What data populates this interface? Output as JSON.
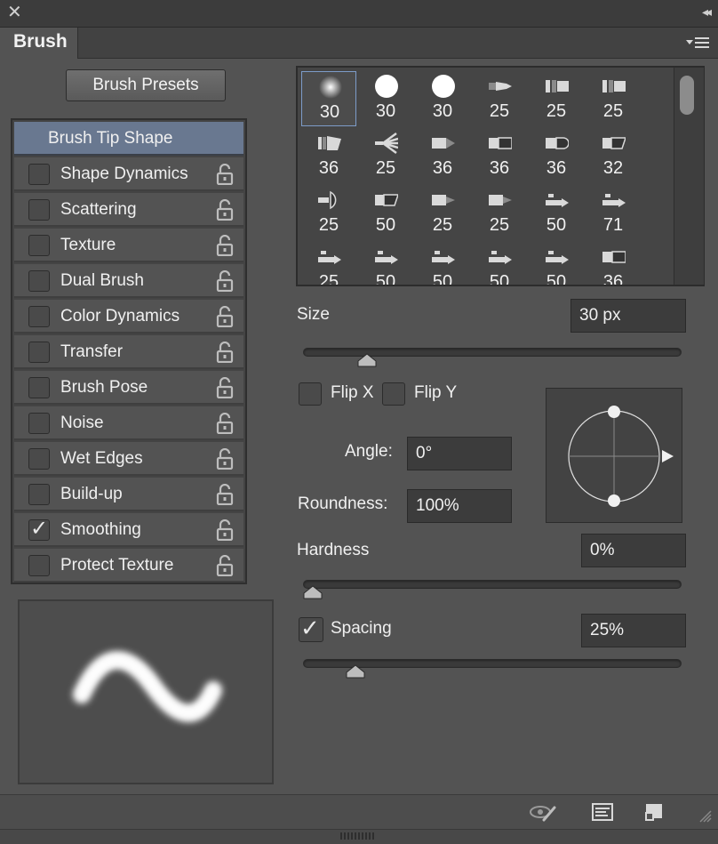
{
  "window": {
    "close_glyph": "✕",
    "collapse_glyph": "◂◂"
  },
  "tab": {
    "title": "Brush"
  },
  "presets_button": "Brush Presets",
  "options": {
    "header": "Brush Tip Shape",
    "items": [
      {
        "label": "Shape Dynamics",
        "checked": false
      },
      {
        "label": "Scattering",
        "checked": false
      },
      {
        "label": "Texture",
        "checked": false
      },
      {
        "label": "Dual Brush",
        "checked": false
      },
      {
        "label": "Color Dynamics",
        "checked": false
      },
      {
        "label": "Transfer",
        "checked": false
      },
      {
        "label": "Brush Pose",
        "checked": false
      },
      {
        "label": "Noise",
        "checked": false
      },
      {
        "label": "Wet Edges",
        "checked": false
      },
      {
        "label": "Build-up",
        "checked": false
      },
      {
        "label": "Smoothing",
        "checked": true
      },
      {
        "label": "Protect Texture",
        "checked": false
      }
    ]
  },
  "brush_grid": {
    "rows": [
      [
        {
          "size": "30",
          "tip": "soft-round"
        },
        {
          "size": "30",
          "tip": "hard-round"
        },
        {
          "size": "30",
          "tip": "hard-round"
        },
        {
          "size": "25",
          "tip": "pointed-bristle"
        },
        {
          "size": "25",
          "tip": "flat-bristle"
        },
        {
          "size": "25",
          "tip": "flat-bristle"
        }
      ],
      [
        {
          "size": "36",
          "tip": "angled-bristle"
        },
        {
          "size": "25",
          "tip": "fan-bristle"
        },
        {
          "size": "36",
          "tip": "point-tip"
        },
        {
          "size": "36",
          "tip": "blunt-tip"
        },
        {
          "size": "36",
          "tip": "round-tip"
        },
        {
          "size": "32",
          "tip": "angle-tip"
        }
      ],
      [
        {
          "size": "25",
          "tip": "fan-tip"
        },
        {
          "size": "50",
          "tip": "angle-tip"
        },
        {
          "size": "25",
          "tip": "pencil-tip"
        },
        {
          "size": "25",
          "tip": "pencil-tip"
        },
        {
          "size": "50",
          "tip": "marker-tip"
        },
        {
          "size": "71",
          "tip": "marker-tip"
        }
      ],
      [
        {
          "size": "25",
          "tip": "marker-tip"
        },
        {
          "size": "50",
          "tip": "marker-tip"
        },
        {
          "size": "50",
          "tip": "marker-tip"
        },
        {
          "size": "50",
          "tip": "marker-tip"
        },
        {
          "size": "50",
          "tip": "marker-tip"
        },
        {
          "size": "36",
          "tip": "blunt-tip"
        }
      ]
    ],
    "selected_index": 0
  },
  "size": {
    "label": "Size",
    "value": "30 px",
    "slider_fraction": 0.15
  },
  "flip_x": {
    "label": "Flip X",
    "checked": false
  },
  "flip_y": {
    "label": "Flip Y",
    "checked": false
  },
  "angle": {
    "label": "Angle:",
    "value": "0°"
  },
  "roundness": {
    "label": "Roundness:",
    "value": "100%"
  },
  "hardness": {
    "label": "Hardness",
    "value": "0%",
    "slider_fraction": 0.0
  },
  "spacing": {
    "label": "Spacing",
    "value": "25%",
    "checked": true,
    "slider_fraction": 0.12
  },
  "footer": {
    "icons": [
      "visibility-brush-icon",
      "brush-editor-icon",
      "new-preset-icon"
    ]
  },
  "colors": {
    "panel_bg": "#535353",
    "header_highlight": "#697890",
    "selection_border": "#7d9cc9"
  }
}
